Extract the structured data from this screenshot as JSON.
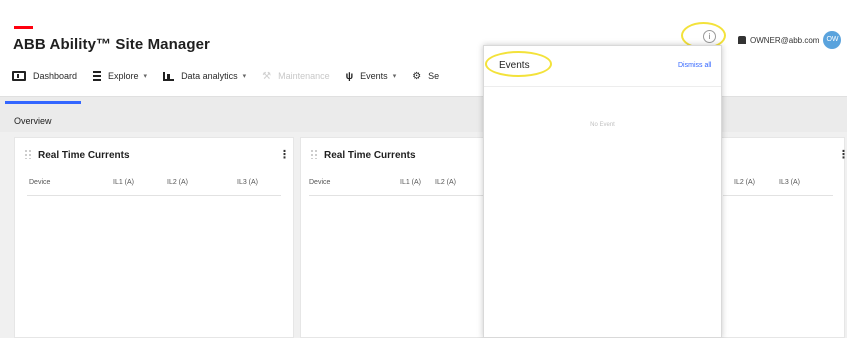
{
  "header": {
    "title": "ABB Ability™ Site Manager",
    "user_email": "OWNER@abb.com",
    "avatar_initials": "OW",
    "info_glyph": "i"
  },
  "nav": {
    "dashboard": "Dashboard",
    "explore": "Explore",
    "data_analytics": "Data analytics",
    "maintenance": "Maintenance",
    "events": "Events",
    "settings": "Se"
  },
  "tabs": {
    "overview": "Overview"
  },
  "cards": [
    {
      "title": "Real Time Currents",
      "columns": [
        "Device",
        "IL1 (A)",
        "IL2 (A)",
        "IL3 (A)"
      ]
    },
    {
      "title": "Real Time Currents",
      "columns": [
        "Device",
        "IL1 (A)",
        "IL2 (A)"
      ]
    },
    {
      "columns": [
        "IL2 (A)",
        "IL3 (A)"
      ]
    }
  ],
  "events_panel": {
    "title": "Events",
    "dismiss_label": "Dismiss all",
    "empty_text": "No Event"
  },
  "icons": {
    "info": "info-icon",
    "user": "user-icon",
    "dashboard": "dashboard-icon",
    "explore": "explore-icon",
    "analytics": "analytics-icon",
    "maintenance": "wrench-icon",
    "events": "events-icon",
    "settings": "gear-icon"
  },
  "colors": {
    "brand_red": "#ff000f",
    "accent_blue": "#3366ff",
    "highlight_yellow": "#f3e23a",
    "avatar_blue": "#5aa3dd"
  }
}
